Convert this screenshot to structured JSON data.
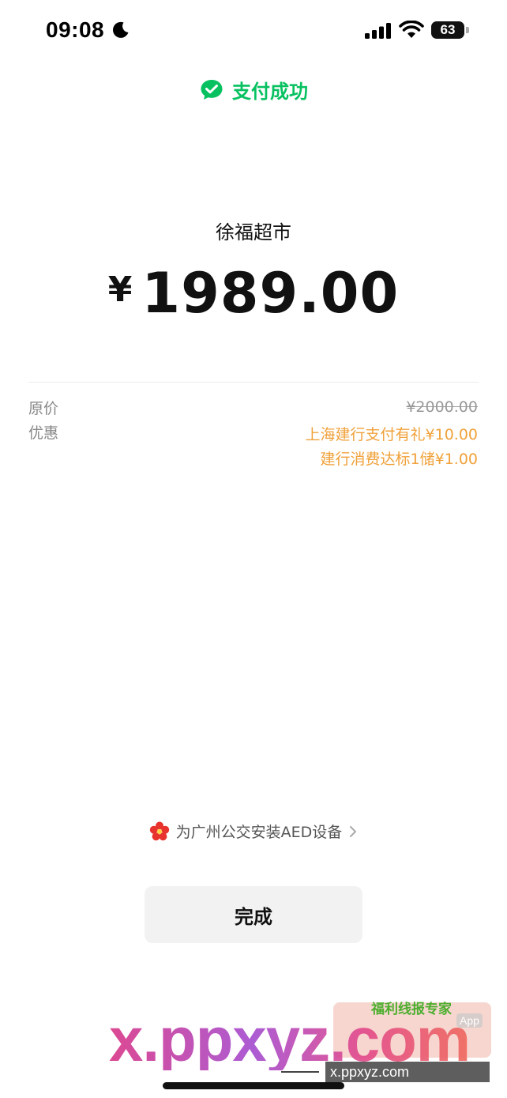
{
  "status_bar": {
    "time": "09:08",
    "battery": "63",
    "icons": [
      "moon-icon",
      "signal-icon",
      "wifi-icon",
      "battery-icon"
    ]
  },
  "header": {
    "title": "支付成功",
    "icon": "wechat-pay-check-icon",
    "accent_color": "#07c160"
  },
  "payment": {
    "merchant": "徐福超市",
    "currency_symbol": "¥",
    "amount": "1989.00"
  },
  "details": {
    "original_label": "原价",
    "original_value": "¥2000.00",
    "discount_label": "优惠",
    "discounts": [
      "上海建行支付有礼¥10.00",
      "建行消费达标1储¥1.00"
    ],
    "discount_color": "#f0a13a"
  },
  "promo": {
    "text": "为广州公交安装AED设备",
    "icon": "red-flower-icon"
  },
  "actions": {
    "done_label": "完成"
  },
  "watermark": {
    "main": "x.ppxyz.com",
    "badge_title": "福利线报专家",
    "badge_app": "App",
    "url": "x.ppxyz.com"
  }
}
